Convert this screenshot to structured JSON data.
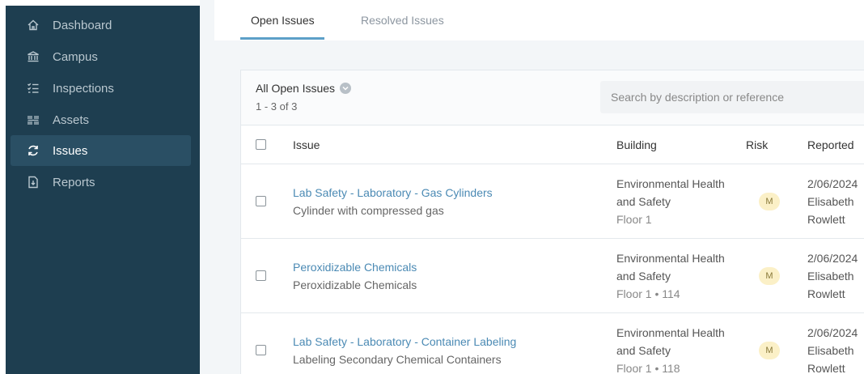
{
  "sidebar": {
    "items": [
      {
        "label": "Dashboard",
        "icon": "home-icon"
      },
      {
        "label": "Campus",
        "icon": "campus-icon"
      },
      {
        "label": "Inspections",
        "icon": "checklist-icon"
      },
      {
        "label": "Assets",
        "icon": "barcode-icon"
      },
      {
        "label": "Issues",
        "icon": "refresh-icon"
      },
      {
        "label": "Reports",
        "icon": "report-icon"
      }
    ],
    "active": "Issues"
  },
  "tabs": [
    {
      "label": "Open Issues",
      "active": true
    },
    {
      "label": "Resolved Issues",
      "active": false
    }
  ],
  "list": {
    "filter_label": "All Open Issues",
    "count_text": "1 - 3 of 3",
    "search_placeholder": "Search by description or reference"
  },
  "table": {
    "headers": {
      "issue": "Issue",
      "building": "Building",
      "risk": "Risk",
      "reported": "Reported"
    },
    "rows": [
      {
        "title": "Lab Safety - Laboratory - Gas Cylinders",
        "description": "Cylinder with compressed gas",
        "building_line1": "Environmental Health",
        "building_line2": "and Safety",
        "floor": "Floor 1",
        "risk": "M",
        "date": "2/06/2024",
        "reporter_first": "Elisabeth",
        "reporter_last": "Rowlett"
      },
      {
        "title": "Peroxidizable Chemicals",
        "description": "Peroxidizable Chemicals",
        "building_line1": "Environmental Health",
        "building_line2": "and Safety",
        "floor": "Floor 1 • 114",
        "risk": "M",
        "date": "2/06/2024",
        "reporter_first": "Elisabeth",
        "reporter_last": "Rowlett"
      },
      {
        "title": "Lab Safety - Laboratory - Container Labeling",
        "description": "Labeling Secondary Chemical Containers",
        "building_line1": "Environmental Health",
        "building_line2": "and Safety",
        "floor": "Floor 1 • 118",
        "risk": "M",
        "date": "2/06/2024",
        "reporter_first": "Elisabeth",
        "reporter_last": "Rowlett"
      }
    ]
  },
  "colors": {
    "sidebar_bg": "#1e3e50",
    "accent": "#5da0c8",
    "link": "#4b8ab4",
    "risk_medium_bg": "#fbf0c7"
  }
}
